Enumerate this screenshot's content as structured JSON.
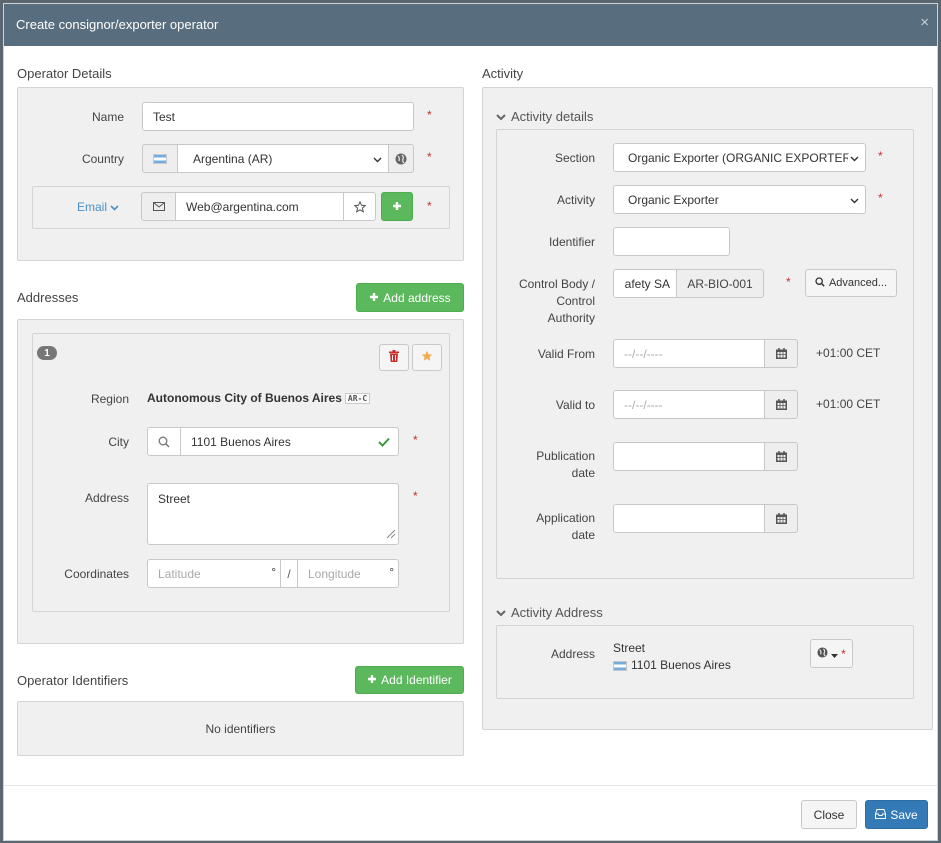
{
  "modal": {
    "title": "Create consignor/exporter operator",
    "close_glyph": "×"
  },
  "operator_details": {
    "title": "Operator Details",
    "name_label": "Name",
    "name_value": "Test",
    "country_label": "Country",
    "country_value": "Argentina (AR)",
    "email_label": "Email",
    "email_value": "Web@argentina.com",
    "required_mark": "*"
  },
  "addresses": {
    "title": "Addresses",
    "add_button": "Add address",
    "index": "1",
    "region_label": "Region",
    "region_value": "Autonomous City of Buenos Aires",
    "region_code": "AR-C",
    "city_label": "City",
    "city_value": "1101 Buenos Aires",
    "address_label": "Address",
    "address_value": "Street",
    "coordinates_label": "Coordinates",
    "latitude_placeholder": "Latitude",
    "longitude_placeholder": "Longitude",
    "degree": "°",
    "separator": "/"
  },
  "identifiers": {
    "title": "Operator Identifiers",
    "add_button": "Add Identifier",
    "empty_text": "No identifiers"
  },
  "activity": {
    "title": "Activity",
    "details_title": "Activity details",
    "section_label": "Section",
    "section_value": "Organic Exporter (ORGANIC EXPORTER",
    "activity_label": "Activity",
    "activity_value": "Organic Exporter",
    "identifier_label": "Identifier",
    "identifier_value": "",
    "control_body_label_1": "Control Body /",
    "control_body_label_2": "Control",
    "control_body_label_3": "Authority",
    "control_body_value": "afety SA",
    "control_body_code": "AR-BIO-001",
    "advanced_button": "Advanced...",
    "valid_from_label": "Valid From",
    "valid_from_placeholder": "--/--/----",
    "valid_to_label": "Valid to",
    "valid_to_placeholder": "--/--/----",
    "timezone": "+01:00 CET",
    "publication_label_1": "Publication",
    "publication_label_2": "date",
    "application_label_1": "Application",
    "application_label_2": "date"
  },
  "activity_address": {
    "title": "Activity Address",
    "address_label": "Address",
    "street": "Street",
    "city": "1101 Buenos Aires"
  },
  "footer": {
    "close_button": "Close",
    "save_button": "Save"
  },
  "colors": {
    "header_bg": "#586e7f",
    "success": "#5cb85c",
    "primary": "#337ab7",
    "danger": "#c9302c",
    "warning_star": "#f0ad4e",
    "link": "#4a90c8"
  }
}
